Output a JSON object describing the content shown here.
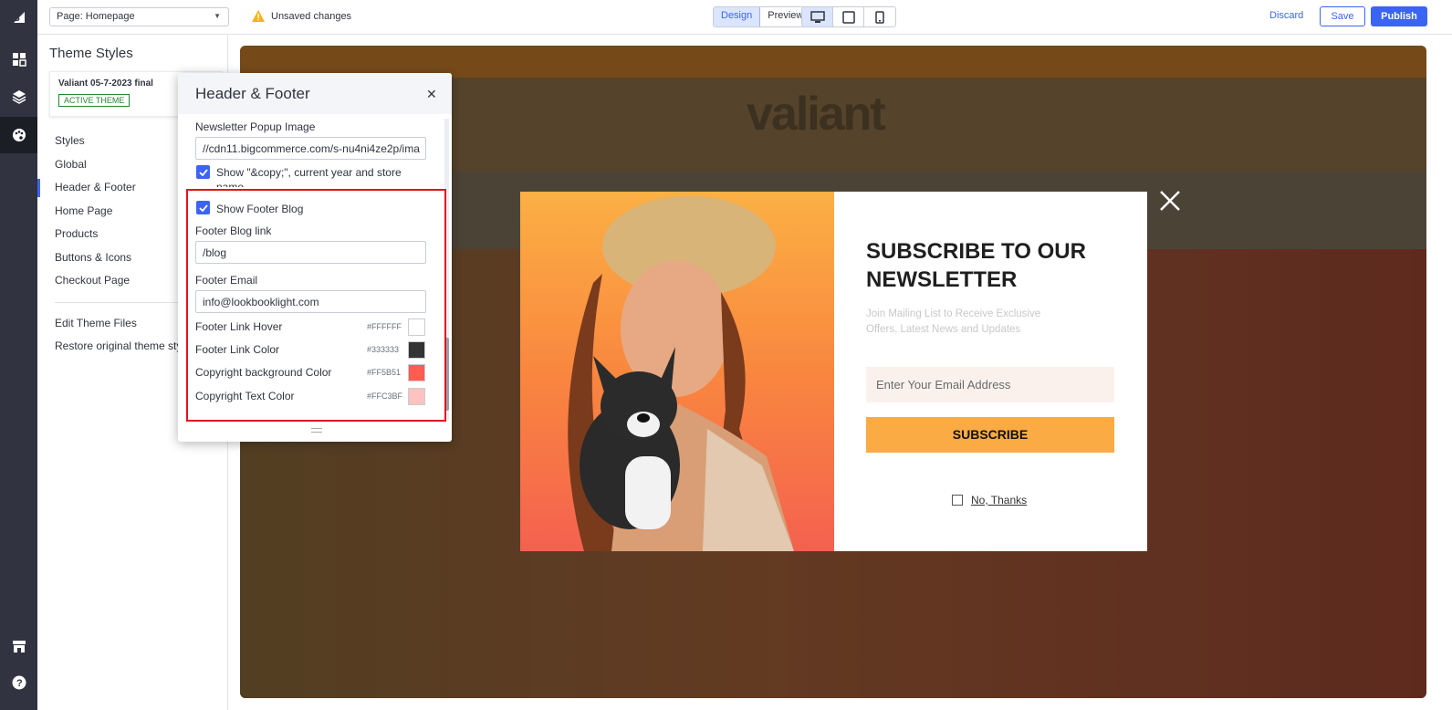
{
  "topbar": {
    "page_select": "Page: Homepage",
    "unsaved": "Unsaved changes",
    "mode_design": "Design",
    "mode_preview": "Preview",
    "discard": "Discard",
    "save": "Save",
    "publish": "Publish"
  },
  "sidepanel": {
    "title": "Theme Styles",
    "theme_name": "Valiant 05-7-2023 final",
    "active_badge": "ACTIVE THEME",
    "items": [
      "Styles",
      "Global",
      "Header & Footer",
      "Home Page",
      "Products",
      "Buttons & Icons",
      "Checkout Page"
    ],
    "edit_files": "Edit Theme Files",
    "restore": "Restore original theme sty"
  },
  "hf_panel": {
    "title": "Header & Footer",
    "newsletter_label": "Newsletter Popup Image",
    "newsletter_value": "//cdn11.bigcommerce.com/s-nu4ni4ze2p/ima",
    "show_copy_label": "Show \"&copy;\", current year and store name",
    "show_blog_label": "Show Footer Blog",
    "blog_link_label": "Footer Blog link",
    "blog_link_value": "/blog",
    "email_label": "Footer Email",
    "email_value": "info@lookbooklight.com",
    "colors": [
      {
        "label": "Footer Link Hover",
        "hex": "#FFFFFF"
      },
      {
        "label": "Footer Link Color",
        "hex": "#333333"
      },
      {
        "label": "Copyright background Color",
        "hex": "#FF5B51"
      },
      {
        "label": "Copyright Text Color",
        "hex": "#FFC3BF"
      }
    ]
  },
  "popup": {
    "title": "SUBSCRIBE TO OUR NEWSLETTER",
    "subtitle": "Join Mailing List to Receive Exclusive Offers, Latest News and Updates",
    "email_placeholder": "Enter Your Email Address",
    "subscribe": "SUBSCRIBE",
    "no_thanks": "No, Thanks"
  },
  "preview": {
    "logo": "valiant"
  },
  "colors": {
    "accent": "#3c64f4",
    "rail": "#313440",
    "subscribe_btn": "#fbab43",
    "highlight": "#e0141e"
  }
}
